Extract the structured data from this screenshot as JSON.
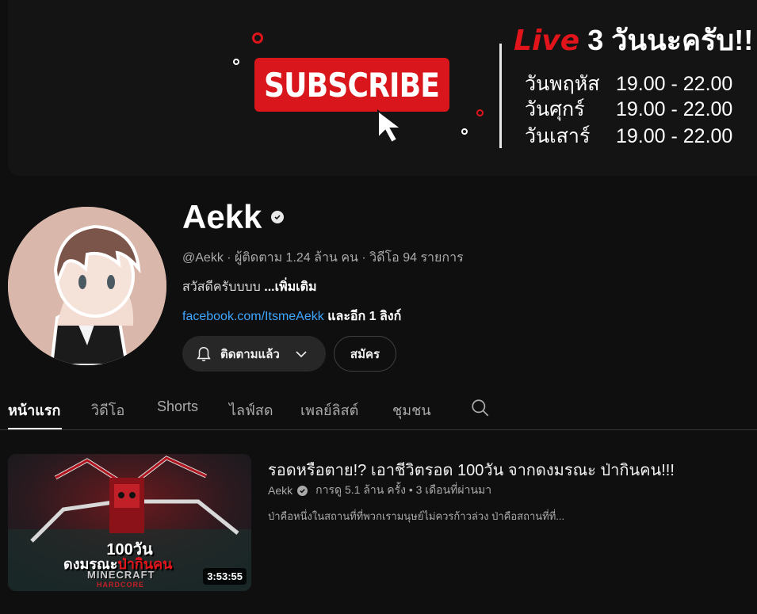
{
  "banner": {
    "subscribe_text": "SUBSCRIBE",
    "live_word": "Live",
    "live_rest": "3 วันนะครับ!!",
    "schedule": [
      {
        "day": "วันพฤหัส",
        "time": "19.00 - 22.00"
      },
      {
        "day": "วันศุกร์",
        "time": "19.00 - 22.00"
      },
      {
        "day": "วันเสาร์",
        "time": "19.00 - 22.00"
      }
    ]
  },
  "channel": {
    "name": "Aekk",
    "meta": "@Aekk · ผู้ติดตาม 1.24 ล้าน คน · วิดีโอ 94 รายการ",
    "description": "สวัสดีครับบบบ ",
    "more": "...เพิ่มเติม",
    "link": "facebook.com/ItsmeAekk",
    "more_links": " และอีก 1 ลิงก์",
    "subscribed_label": "ติดตามแล้ว",
    "join_label": "สมัคร"
  },
  "tabs": [
    "หน้าแรก",
    "วิดีโอ",
    "Shorts",
    "ไลฟ์สด",
    "เพลย์ลิสต์",
    "ชุมชน"
  ],
  "video": {
    "title": "รอดหรือตาย!? เอาชีวิตรอด 100วัน จากดงมรณะ ป่ากินคน!!!",
    "channel": "Aekk",
    "stats": "การดู 5.1 ล้าน ครั้ง • 3 เดือนที่ผ่านมา",
    "description": "ป่าคือหนึ่งในสถานที่ที่พวกเรามนุษย์ไม่ควรก้าวล่วง ป่าคือสถานที่ที่...",
    "duration": "3:53:55",
    "thumb_line1": "100วัน",
    "thumb_line2": "ดงมรณะ",
    "thumb_line2b": "ป่ากินคน",
    "thumb_brand": "MINECRAFT",
    "thumb_sub": "HARDCORE"
  },
  "colors": {
    "background": "#0f0f0f",
    "subscribe_red": "#d8161b",
    "link_blue": "#3ea6ff",
    "secondary_text": "#aaaaaa"
  }
}
